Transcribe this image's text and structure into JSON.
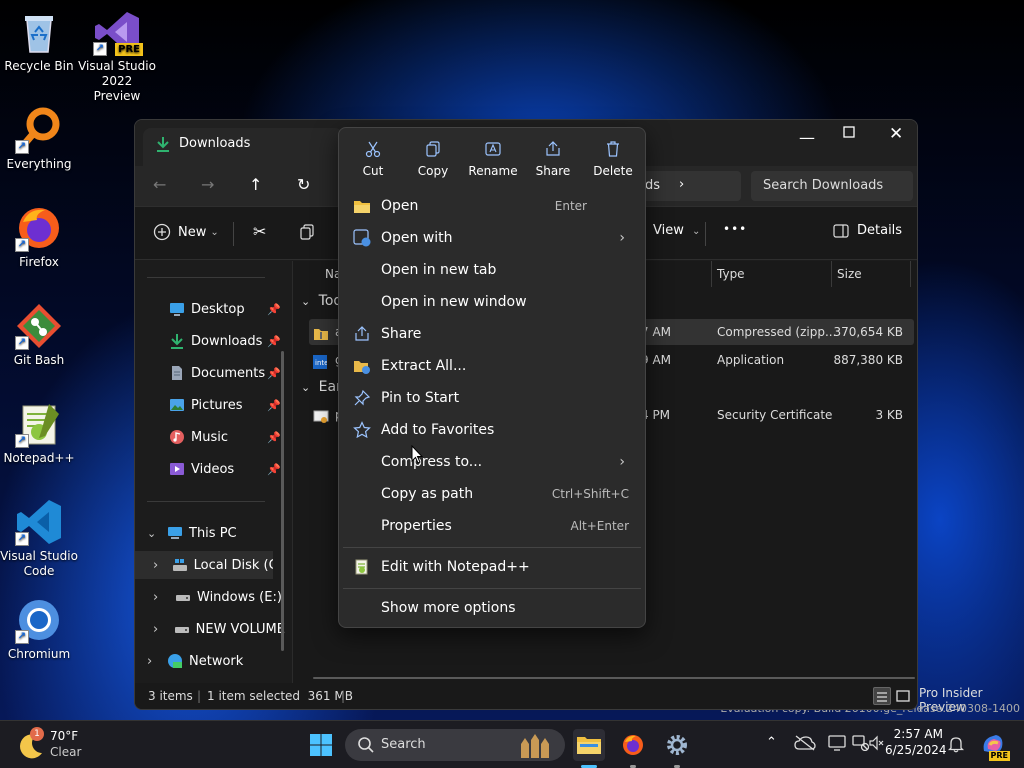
{
  "desktop": {
    "icons": [
      {
        "label": "Recycle Bin",
        "icon": "recycle-bin-icon"
      },
      {
        "label": "Visual Studio 2022 Preview",
        "badge": "PRE",
        "icon": "visual-studio-icon"
      },
      {
        "label": "Everything",
        "icon": "everything-search-icon"
      },
      {
        "label": "Firefox",
        "icon": "firefox-icon"
      },
      {
        "label": "Git Bash",
        "icon": "git-bash-icon"
      },
      {
        "label": "Notepad++",
        "icon": "notepad-plus-plus-icon"
      },
      {
        "label": "Visual Studio Code",
        "icon": "vscode-icon"
      },
      {
        "label": "Chromium",
        "icon": "chromium-icon"
      }
    ],
    "watermark_line1": "Pro Insider Preview",
    "watermark_line2": "Evaluation copy. Build 26100.ge_release.240308-1400"
  },
  "explorer": {
    "title": "Downloads",
    "address_tail": "ds",
    "search_placeholder": "Search Downloads",
    "cmd": {
      "new": "New",
      "view": "View",
      "more": "•••",
      "details": "Details"
    },
    "sidebar": {
      "quick": [
        {
          "label": "Desktop",
          "icon": "desktop-icon"
        },
        {
          "label": "Downloads",
          "icon": "downloads-icon"
        },
        {
          "label": "Documents",
          "icon": "documents-icon"
        },
        {
          "label": "Pictures",
          "icon": "pictures-icon"
        },
        {
          "label": "Music",
          "icon": "music-icon"
        },
        {
          "label": "Videos",
          "icon": "videos-icon"
        }
      ],
      "this_pc": "This PC",
      "drives": [
        "Local Disk (C:)",
        "Windows (E:)",
        "NEW VOLUME"
      ],
      "network": "Network"
    },
    "columns": {
      "name": "Nam",
      "type": "Type",
      "size": "Size"
    },
    "groups": {
      "today": "Tod",
      "earlier": "Earl"
    },
    "files": [
      {
        "name": "a",
        "time": "7 AM",
        "type": "Compressed (zipp...",
        "size": "370,654 KB",
        "selected": true
      },
      {
        "name": "g",
        "time": "9 AM",
        "type": "Application",
        "size": "887,380 KB",
        "selected": false
      },
      {
        "name": "p",
        "time": "4 PM",
        "type": "Security Certificate",
        "size": "3 KB",
        "selected": false
      }
    ],
    "status": {
      "items": "3 items",
      "selected": "1 item selected  361 MB"
    }
  },
  "context_menu": {
    "quick_actions": [
      {
        "label": "Cut",
        "icon": "scissors-icon"
      },
      {
        "label": "Copy",
        "icon": "copy-icon"
      },
      {
        "label": "Rename",
        "icon": "rename-icon"
      },
      {
        "label": "Share",
        "icon": "share-icon"
      },
      {
        "label": "Delete",
        "icon": "trash-icon"
      }
    ],
    "items": [
      {
        "label": "Open",
        "shortcut": "Enter",
        "icon": "folder-open-icon"
      },
      {
        "label": "Open with",
        "submenu": true,
        "icon": "open-with-icon"
      },
      {
        "label": "Open in new tab"
      },
      {
        "label": "Open in new window"
      },
      {
        "label": "Share",
        "icon": "share-icon"
      },
      {
        "label": "Extract All...",
        "icon": "extract-icon"
      },
      {
        "label": "Pin to Start",
        "icon": "pin-icon"
      },
      {
        "label": "Add to Favorites",
        "icon": "star-icon"
      },
      {
        "label": "Compress to...",
        "submenu": true
      },
      {
        "label": "Copy as path",
        "shortcut": "Ctrl+Shift+C"
      },
      {
        "label": "Properties",
        "shortcut": "Alt+Enter"
      },
      {
        "label": "Edit with Notepad++",
        "icon": "notepad-plus-plus-icon"
      },
      {
        "label": "Show more options"
      }
    ]
  },
  "taskbar": {
    "weather_temp": "70°F",
    "weather_desc": "Clear",
    "weather_badge": "1",
    "search": "Search",
    "time": "2:57 AM",
    "date": "6/25/2024"
  }
}
